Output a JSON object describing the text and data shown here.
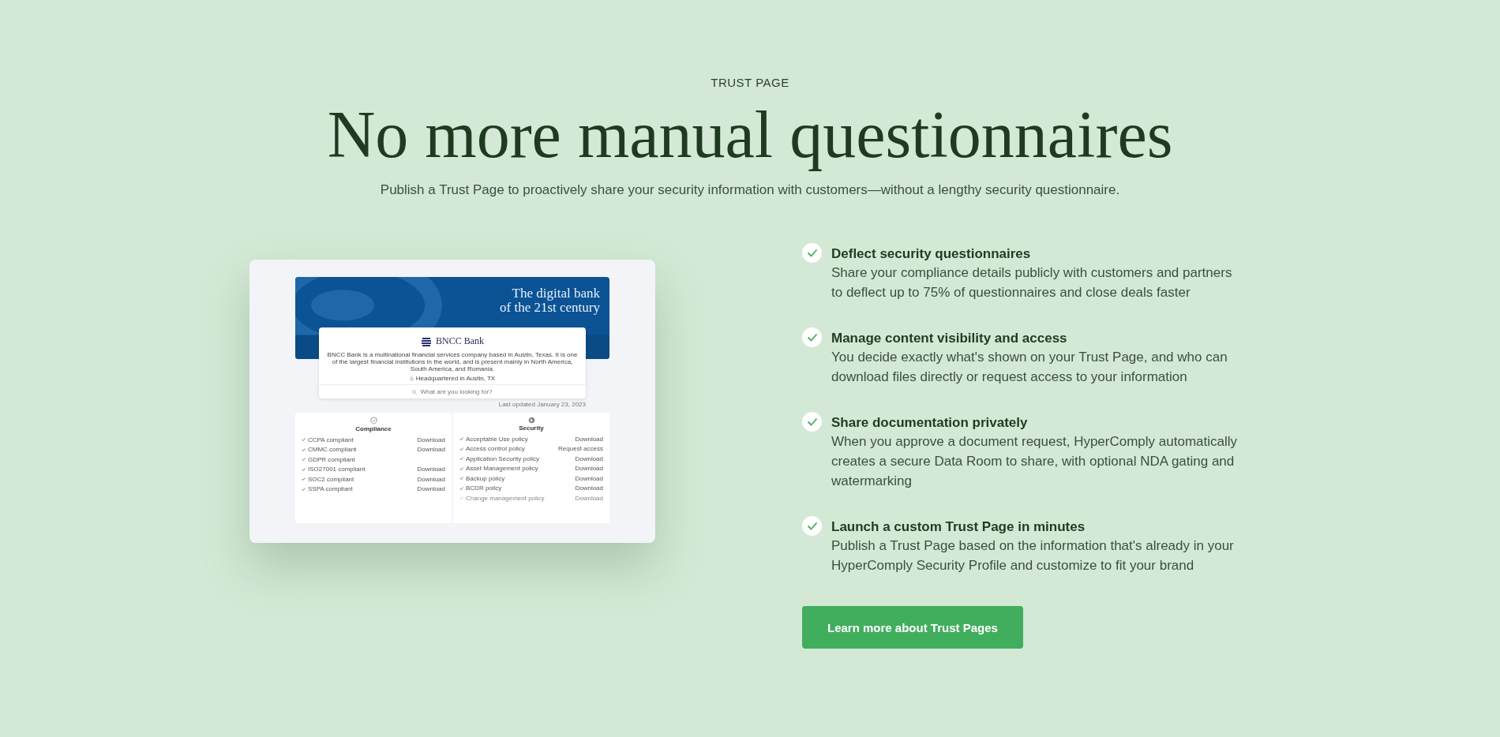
{
  "eyebrow": "TRUST PAGE",
  "title": "No more manual questionnaires",
  "subtitle": "Publish a Trust Page to proactively share your security information with customers—without a lengthy security questionnaire.",
  "preview": {
    "banner_title": [
      "The digital bank",
      "of the 21st century"
    ],
    "company": "BNCC Bank",
    "description": "BNCC Bank is a multinational financial services company based in Austin, Texas. It is one of the largest financial institutions in the world, and is present mainly in North America, South America, and Romania.",
    "location": "Headquartered in Austin, TX",
    "search": {
      "placeholder": "What are you looking for?"
    },
    "updated": "Last updated January 23, 2023",
    "sections": [
      {
        "title": "Compliance",
        "items": [
          {
            "label": "CCPA compliant",
            "action": "Download"
          },
          {
            "label": "CMMC compliant",
            "action": "Download"
          },
          {
            "label": "GDPR compliant"
          },
          {
            "label": "ISO27001 compliant",
            "action": "Download"
          },
          {
            "label": "SOC2 compliant",
            "action": "Download"
          },
          {
            "label": "SSPA compliant",
            "action": "Download"
          }
        ]
      },
      {
        "title": "Security",
        "items": [
          {
            "label": "Acceptable Use policy",
            "action": "Download"
          },
          {
            "label": "Access control policy",
            "action": "Request access"
          },
          {
            "label": "Application Security policy",
            "action": "Download"
          },
          {
            "label": "Asset Management policy",
            "action": "Download"
          },
          {
            "label": "Backup policy",
            "action": "Download"
          },
          {
            "label": "BCDR policy",
            "action": "Download"
          },
          {
            "label": "Change management policy",
            "action": "Download"
          }
        ]
      }
    ]
  },
  "features": [
    {
      "title": "Deflect security questionnaires",
      "text": "Share your compliance details publicly with customers and partners to deflect up to 75% of questionnaires and close deals faster"
    },
    {
      "title": "Manage content visibility and access",
      "text": "You decide exactly what's shown on your Trust Page, and who can download files directly or request access to your information"
    },
    {
      "title": "Share documentation privately",
      "text": "When you approve a document request, HyperComply automatically creates a secure Data Room to share, with optional NDA gating and watermarking"
    },
    {
      "title": "Launch a custom Trust Page in minutes",
      "text": "Publish a Trust Page based on the information that's already in your HyperComply Security Profile and customize to fit your brand"
    }
  ],
  "cta": "Learn more about Trust Pages"
}
